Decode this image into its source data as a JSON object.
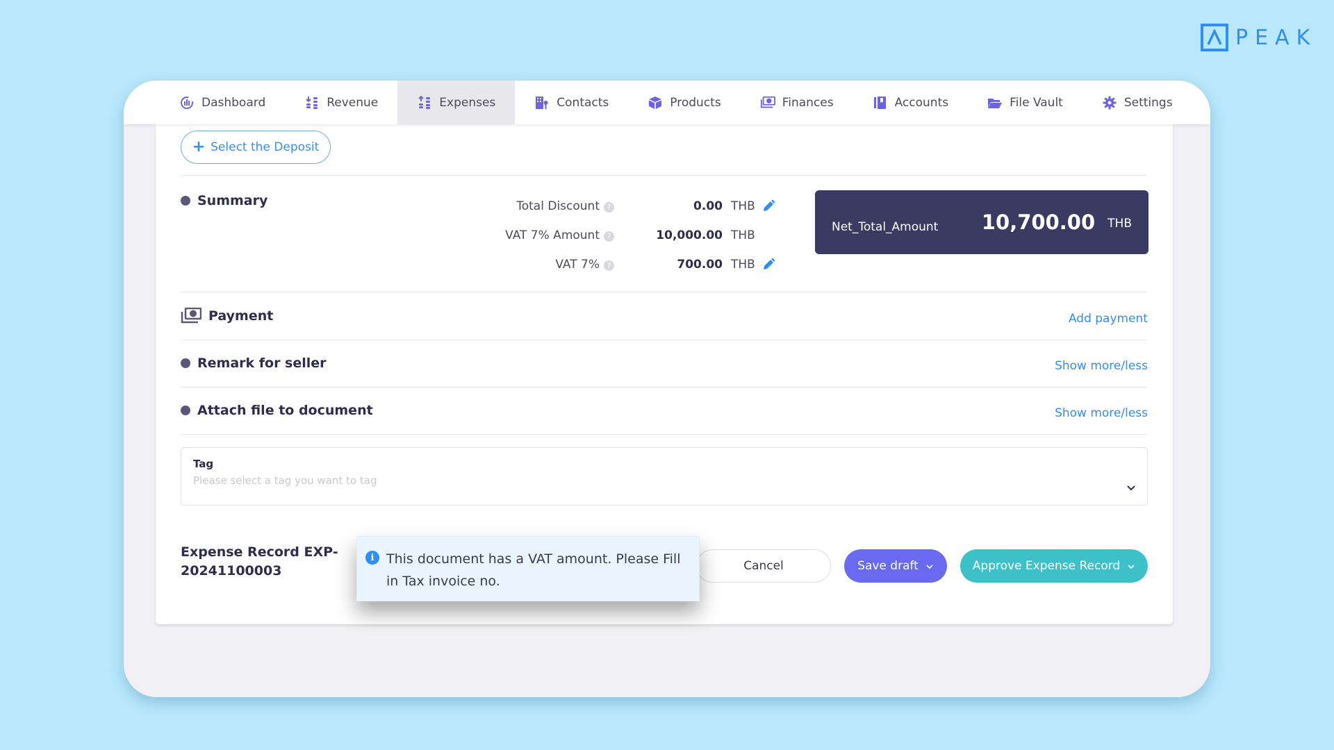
{
  "brand": {
    "logo_text": "PEAK",
    "accent": "#2f8ef0"
  },
  "nav": {
    "items": [
      {
        "label": "Dashboard",
        "icon": "dashboard-icon",
        "active": false
      },
      {
        "label": "Revenue",
        "icon": "revenue-icon",
        "active": false
      },
      {
        "label": "Expenses",
        "icon": "expenses-icon",
        "active": true
      },
      {
        "label": "Contacts",
        "icon": "contacts-icon",
        "active": false
      },
      {
        "label": "Products",
        "icon": "products-icon",
        "active": false
      },
      {
        "label": "Finances",
        "icon": "finances-icon",
        "active": false
      },
      {
        "label": "Accounts",
        "icon": "accounts-icon",
        "active": false
      },
      {
        "label": "File Vault",
        "icon": "folder-icon",
        "active": false
      },
      {
        "label": "Settings",
        "icon": "gear-icon",
        "active": false
      }
    ]
  },
  "deposit": {
    "button_label": "Select the Deposit"
  },
  "summary": {
    "title": "Summary",
    "rows": [
      {
        "label": "Total Discount",
        "value": "0.00",
        "currency": "THB",
        "editable": true
      },
      {
        "label": "VAT 7% Amount",
        "value": "10,000.00",
        "currency": "THB",
        "editable": false
      },
      {
        "label": "VAT 7%",
        "value": "700.00",
        "currency": "THB",
        "editable": true
      }
    ],
    "net_total": {
      "label": "Net_Total_Amount",
      "value": "10,700.00",
      "currency": "THB"
    }
  },
  "payment": {
    "title": "Payment",
    "action": "Add payment"
  },
  "remark": {
    "title": "Remark for seller",
    "action": "Show more/less"
  },
  "attach": {
    "title": "Attach file to document",
    "action": "Show more/less"
  },
  "tag": {
    "label": "Tag",
    "placeholder": "Please select a tag you want to tag"
  },
  "footer": {
    "record_title": "Expense Record EXP-20241100003",
    "cancel_label": "Cancel",
    "save_label": "Save draft",
    "approve_label": "Approve Expense Record"
  },
  "toast": {
    "message": "This document has a VAT amount. Please Fill in Tax invoice no."
  }
}
